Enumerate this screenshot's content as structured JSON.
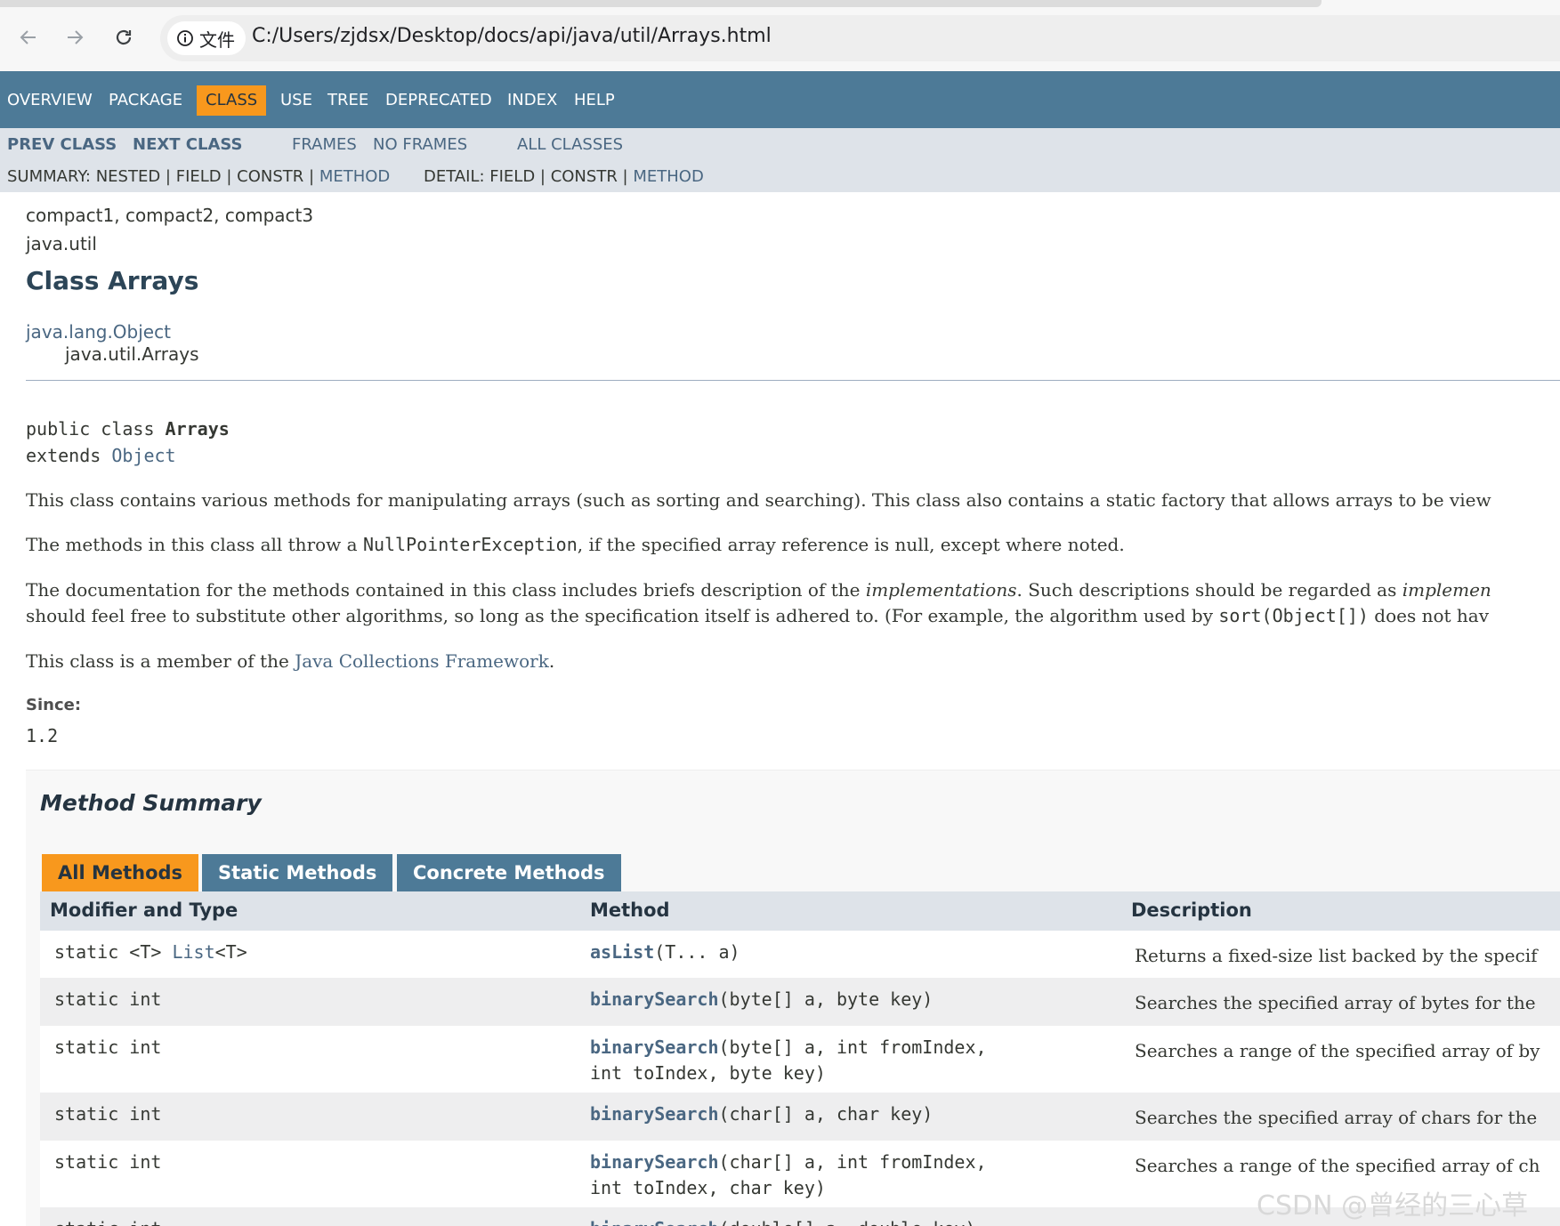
{
  "browser": {
    "info_label": "文件",
    "url": "C:/Users/zjdsx/Desktop/docs/api/java/util/Arrays.html"
  },
  "topnav": {
    "items": [
      "OVERVIEW",
      "PACKAGE",
      "CLASS",
      "USE",
      "TREE",
      "DEPRECATED",
      "INDEX",
      "HELP"
    ],
    "active": "CLASS"
  },
  "subnav": {
    "prev_class": "PREV CLASS",
    "next_class": "NEXT CLASS",
    "frames": "FRAMES",
    "no_frames": "NO FRAMES",
    "all_classes": "ALL CLASSES",
    "summary_prefix": "SUMMARY: NESTED | FIELD | CONSTR |",
    "summary_method": "METHOD",
    "detail_prefix": "DETAIL: FIELD | CONSTR |",
    "detail_method": "METHOD"
  },
  "header": {
    "profiles": "compact1, compact2, compact3",
    "package": "java.util",
    "title": "Class Arrays",
    "inherit_parent": "java.lang.Object",
    "inherit_child": "java.util.Arrays"
  },
  "signature": {
    "line1_prefix": "public class ",
    "line1_name": "Arrays",
    "line2_prefix": "extends ",
    "line2_link": "Object"
  },
  "description": {
    "p1": "This class contains various methods for manipulating arrays (such as sorting and searching). This class also contains a static factory that allows arrays to be view",
    "p2_a": "The methods in this class all throw a ",
    "p2_code": "NullPointerException",
    "p2_b": ", if the specified array reference is null, except where noted.",
    "p3_a": "The documentation for the methods contained in this class includes briefs description of the ",
    "p3_em1": "implementations",
    "p3_b": ". Such descriptions should be regarded as ",
    "p3_em2": "implemen",
    "p3_line2_a": "should feel free to substitute other algorithms, so long as the specification itself is adhered to. (For example, the algorithm used by ",
    "p3_code": "sort(Object[])",
    "p3_line2_b": " does not hav",
    "p4_a": "This class is a member of the ",
    "p4_link": "Java Collections Framework",
    "p4_b": ".",
    "since_label": "Since:",
    "since_value": "1.2"
  },
  "method_summary": {
    "title": "Method Summary",
    "tabs": [
      "All Methods",
      "Static Methods",
      "Concrete Methods"
    ],
    "columns": [
      "Modifier and Type",
      "Method",
      "Description"
    ],
    "rows": [
      {
        "mod_a": "static <T> ",
        "mod_link": "List",
        "mod_b": "<T>",
        "name": "asList",
        "params1": "(T... a)",
        "params2": "",
        "desc": "Returns a fixed-size list backed by the specif"
      },
      {
        "mod_a": "static int",
        "mod_link": "",
        "mod_b": "",
        "name": "binarySearch",
        "params1": "(byte[] a, byte key)",
        "params2": "",
        "desc": "Searches the specified array of bytes for the"
      },
      {
        "mod_a": "static int",
        "mod_link": "",
        "mod_b": "",
        "name": "binarySearch",
        "params1": "(byte[] a, int fromIndex,",
        "params2": "int toIndex, byte key)",
        "desc": "Searches a range of the specified array of by"
      },
      {
        "mod_a": "static int",
        "mod_link": "",
        "mod_b": "",
        "name": "binarySearch",
        "params1": "(char[] a, char key)",
        "params2": "",
        "desc": "Searches the specified array of chars for the"
      },
      {
        "mod_a": "static int",
        "mod_link": "",
        "mod_b": "",
        "name": "binarySearch",
        "params1": "(char[] a, int fromIndex,",
        "params2": "int toIndex, char key)",
        "desc": "Searches a range of the specified array of ch"
      },
      {
        "mod_a": "static int",
        "mod_link": "",
        "mod_b": "",
        "name": "binarySearch",
        "params1": "(double[] a, double key)",
        "params2": "",
        "desc": ""
      }
    ]
  },
  "watermark": "CSDN @曾经的三心草",
  "colors": {
    "nav_bg": "#4d7a97",
    "active_tab": "#f8981d",
    "subnav_bg": "#dee3e9",
    "link": "#4a6782"
  }
}
